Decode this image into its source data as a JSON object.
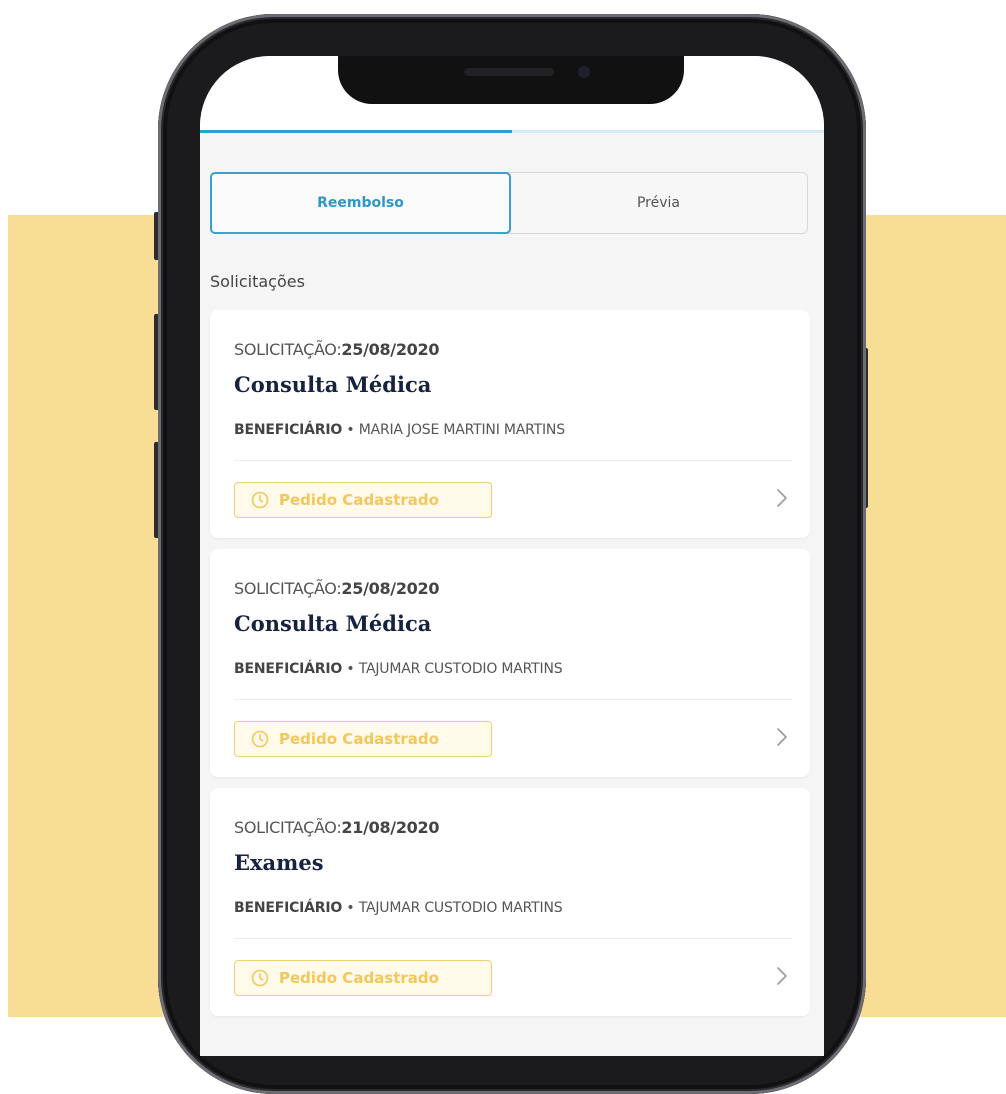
{
  "colors": {
    "background_yellow": "#f8de95",
    "accent_blue": "#2b9fd6",
    "status_yellow": "#f2c75c",
    "title_navy": "#17223f"
  },
  "progress": {
    "fill_fraction": 0.5
  },
  "tabs": [
    {
      "label": "Reembolso",
      "active": true
    },
    {
      "label": "Prévia",
      "active": false
    }
  ],
  "section_title": "Solicitações",
  "requests": [
    {
      "date_prefix": "SOLICITAÇÃO:",
      "date": "25/08/2020",
      "title": "Consulta Médica",
      "beneficiary_label": "BENEFICIÁRIO",
      "separator": "•",
      "beneficiary": "MARIA JOSE MARTINI MARTINS",
      "status": "Pedido Cadastrado",
      "status_icon": "clock-icon",
      "nav_icon": "chevron-right-icon"
    },
    {
      "date_prefix": "SOLICITAÇÃO:",
      "date": "25/08/2020",
      "title": "Consulta Médica",
      "beneficiary_label": "BENEFICIÁRIO",
      "separator": "•",
      "beneficiary": "TAJUMAR CUSTODIO MARTINS",
      "status": "Pedido Cadastrado",
      "status_icon": "clock-icon",
      "nav_icon": "chevron-right-icon"
    },
    {
      "date_prefix": "SOLICITAÇÃO:",
      "date": "21/08/2020",
      "title": "Exames",
      "beneficiary_label": "BENEFICIÁRIO",
      "separator": "•",
      "beneficiary": "TAJUMAR CUSTODIO MARTINS",
      "status": "Pedido Cadastrado",
      "status_icon": "clock-icon",
      "nav_icon": "chevron-right-icon"
    }
  ]
}
